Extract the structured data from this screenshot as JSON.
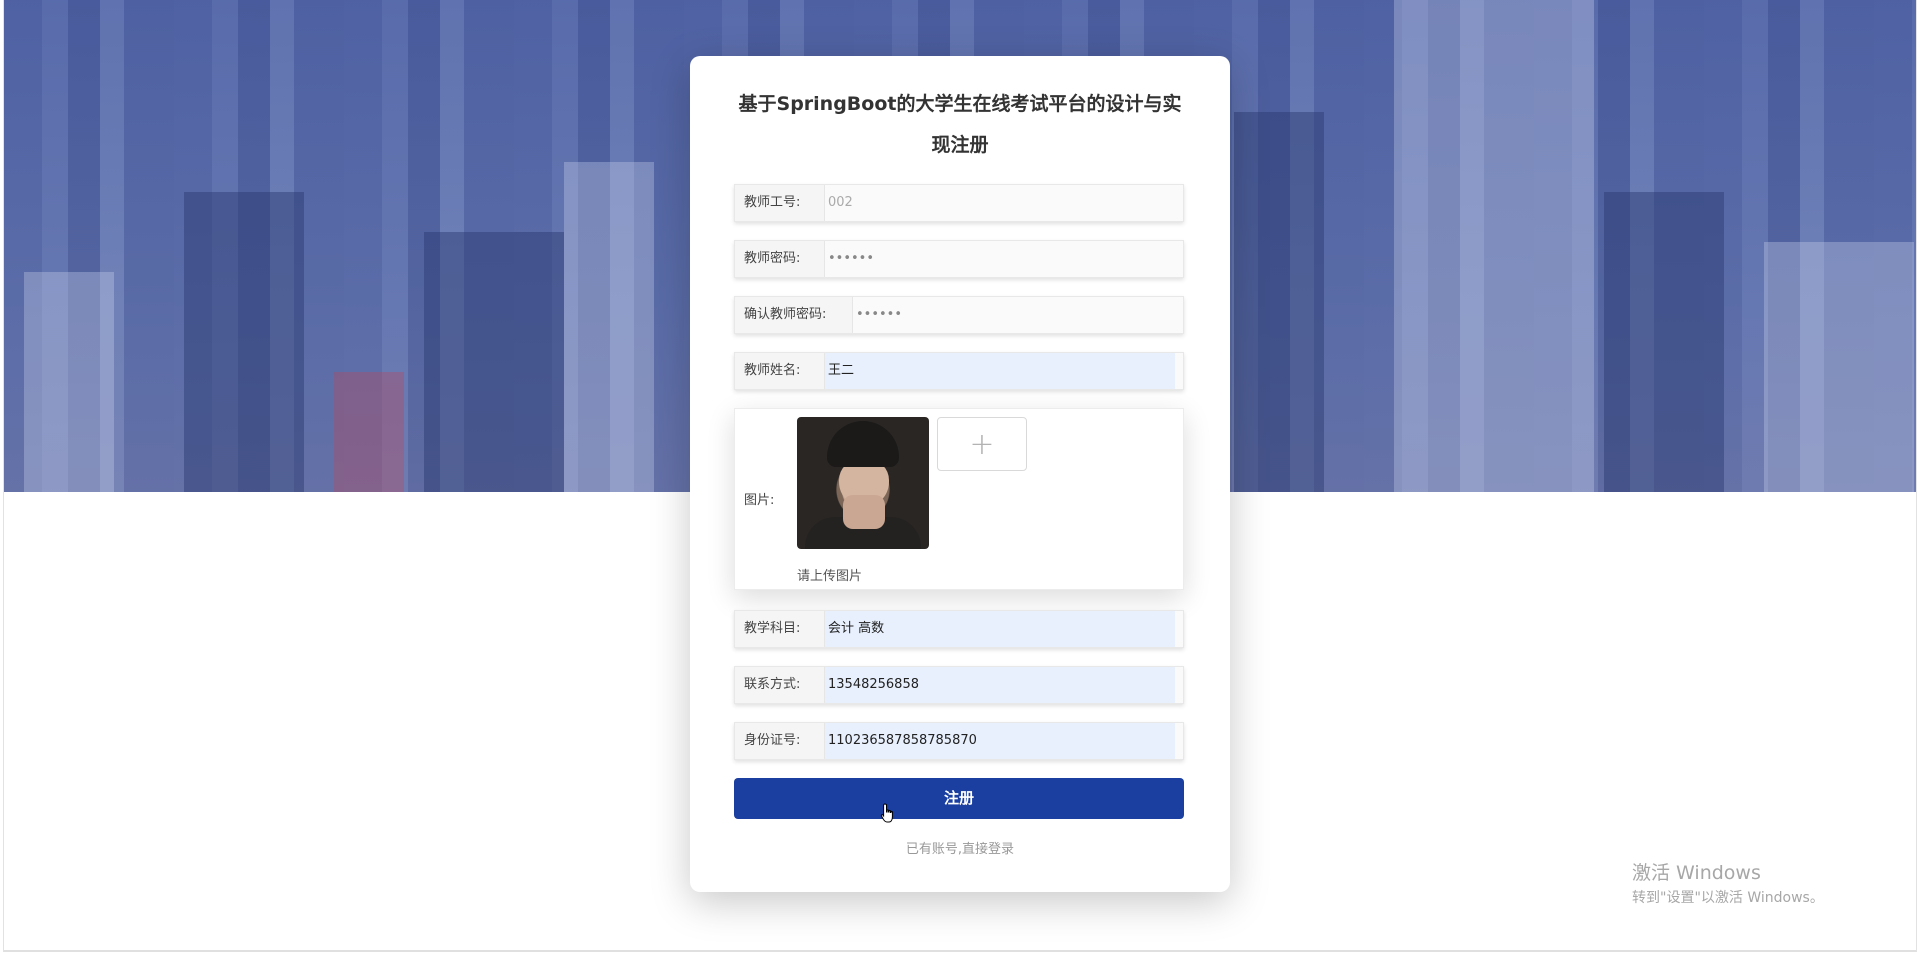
{
  "form": {
    "title": "基于SpringBoot的大学生在线考试平台的设计与实现注册",
    "fields": [
      {
        "label": "教师工号:",
        "value": "002",
        "state": "placeholder"
      },
      {
        "label": "教师密码:",
        "value": "••••••",
        "state": "password"
      },
      {
        "label": "确认教师密码:",
        "value": "••••••",
        "state": "password"
      },
      {
        "label": "教师姓名:",
        "value": "王二",
        "state": "filled"
      }
    ],
    "image": {
      "label": "图片:",
      "upload_icon": "plus-icon",
      "hint": "请上传图片"
    },
    "fields2": [
      {
        "label": "教学科目:",
        "value": "会计 高数",
        "state": "filled"
      },
      {
        "label": "联系方式:",
        "value": "13548256858",
        "state": "filled"
      },
      {
        "label": "身份证号:",
        "value": "110236587858785870",
        "state": "filled"
      }
    ],
    "submit_label": "注册",
    "login_link": "已有账号,直接登录"
  },
  "watermark": {
    "line1": "激活 Windows",
    "line2": "转到\"设置\"以激活 Windows。"
  },
  "colors": {
    "primary": "#1a3fa0",
    "autofill": "#e8f0fe"
  }
}
